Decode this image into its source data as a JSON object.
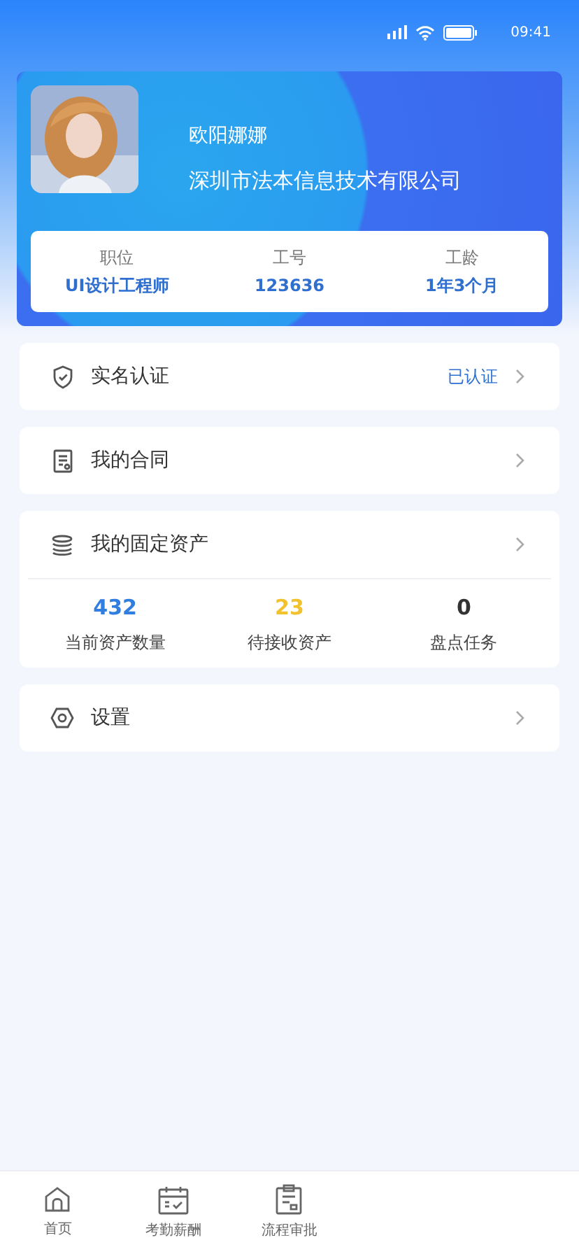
{
  "status_bar": {
    "time": "09:41"
  },
  "profile": {
    "name": "欧阳娜娜",
    "company": "深圳市法本信息技术有限公司",
    "stats": [
      {
        "label": "职位",
        "value": "UI设计工程师"
      },
      {
        "label": "工号",
        "value": "123636"
      },
      {
        "label": "工龄",
        "value": "1年3个月"
      }
    ]
  },
  "menu": [
    {
      "kind": "verify",
      "label": "实名认证",
      "status": "已认证"
    },
    {
      "kind": "contract",
      "label": "我的合同"
    },
    {
      "kind": "assets",
      "label": "我的固定资产",
      "counts": [
        {
          "value": "432",
          "label": "当前资产数量",
          "color": "#2f7ee0"
        },
        {
          "value": "23",
          "label": "待接收资产",
          "color": "#f2c12e"
        },
        {
          "value": "0",
          "label": "盘点任务",
          "color": "#333333"
        }
      ]
    },
    {
      "kind": "settings",
      "label": "设置"
    }
  ],
  "tab_bar": [
    {
      "kind": "home",
      "label": "首页",
      "selected": false
    },
    {
      "kind": "calendar",
      "label": "考勤薪酬",
      "selected": false
    },
    {
      "kind": "clipboard",
      "label": "流程审批",
      "selected": false
    }
  ]
}
